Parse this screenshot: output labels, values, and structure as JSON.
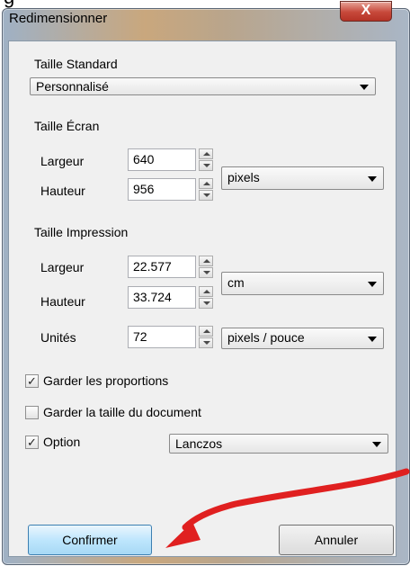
{
  "window": {
    "title": "Redimensionner",
    "close_glyph": "X"
  },
  "taille_standard": {
    "label": "Taille Standard",
    "value": "Personnalisé"
  },
  "taille_ecran": {
    "label": "Taille Écran",
    "largeur_label": "Largeur",
    "largeur_value": "640",
    "hauteur_label": "Hauteur",
    "hauteur_value": "956",
    "unit_value": "pixels"
  },
  "taille_impression": {
    "label": "Taille Impression",
    "largeur_label": "Largeur",
    "largeur_value": "22.577",
    "hauteur_label": "Hauteur",
    "hauteur_value": "33.724",
    "unit_value": "cm",
    "unites_label": "Unités",
    "unites_value": "72",
    "resolution_value": "pixels / pouce"
  },
  "options": {
    "garder_proportions": {
      "label": "Garder les proportions",
      "checked": true
    },
    "garder_taille_document": {
      "label": "Garder la taille du document",
      "checked": false
    },
    "option": {
      "label": "Option",
      "checked": true,
      "value": "Lanczos"
    }
  },
  "buttons": {
    "confirm": "Confirmer",
    "cancel": "Annuler"
  },
  "annotation": {
    "arrow_color": "#e02020"
  }
}
